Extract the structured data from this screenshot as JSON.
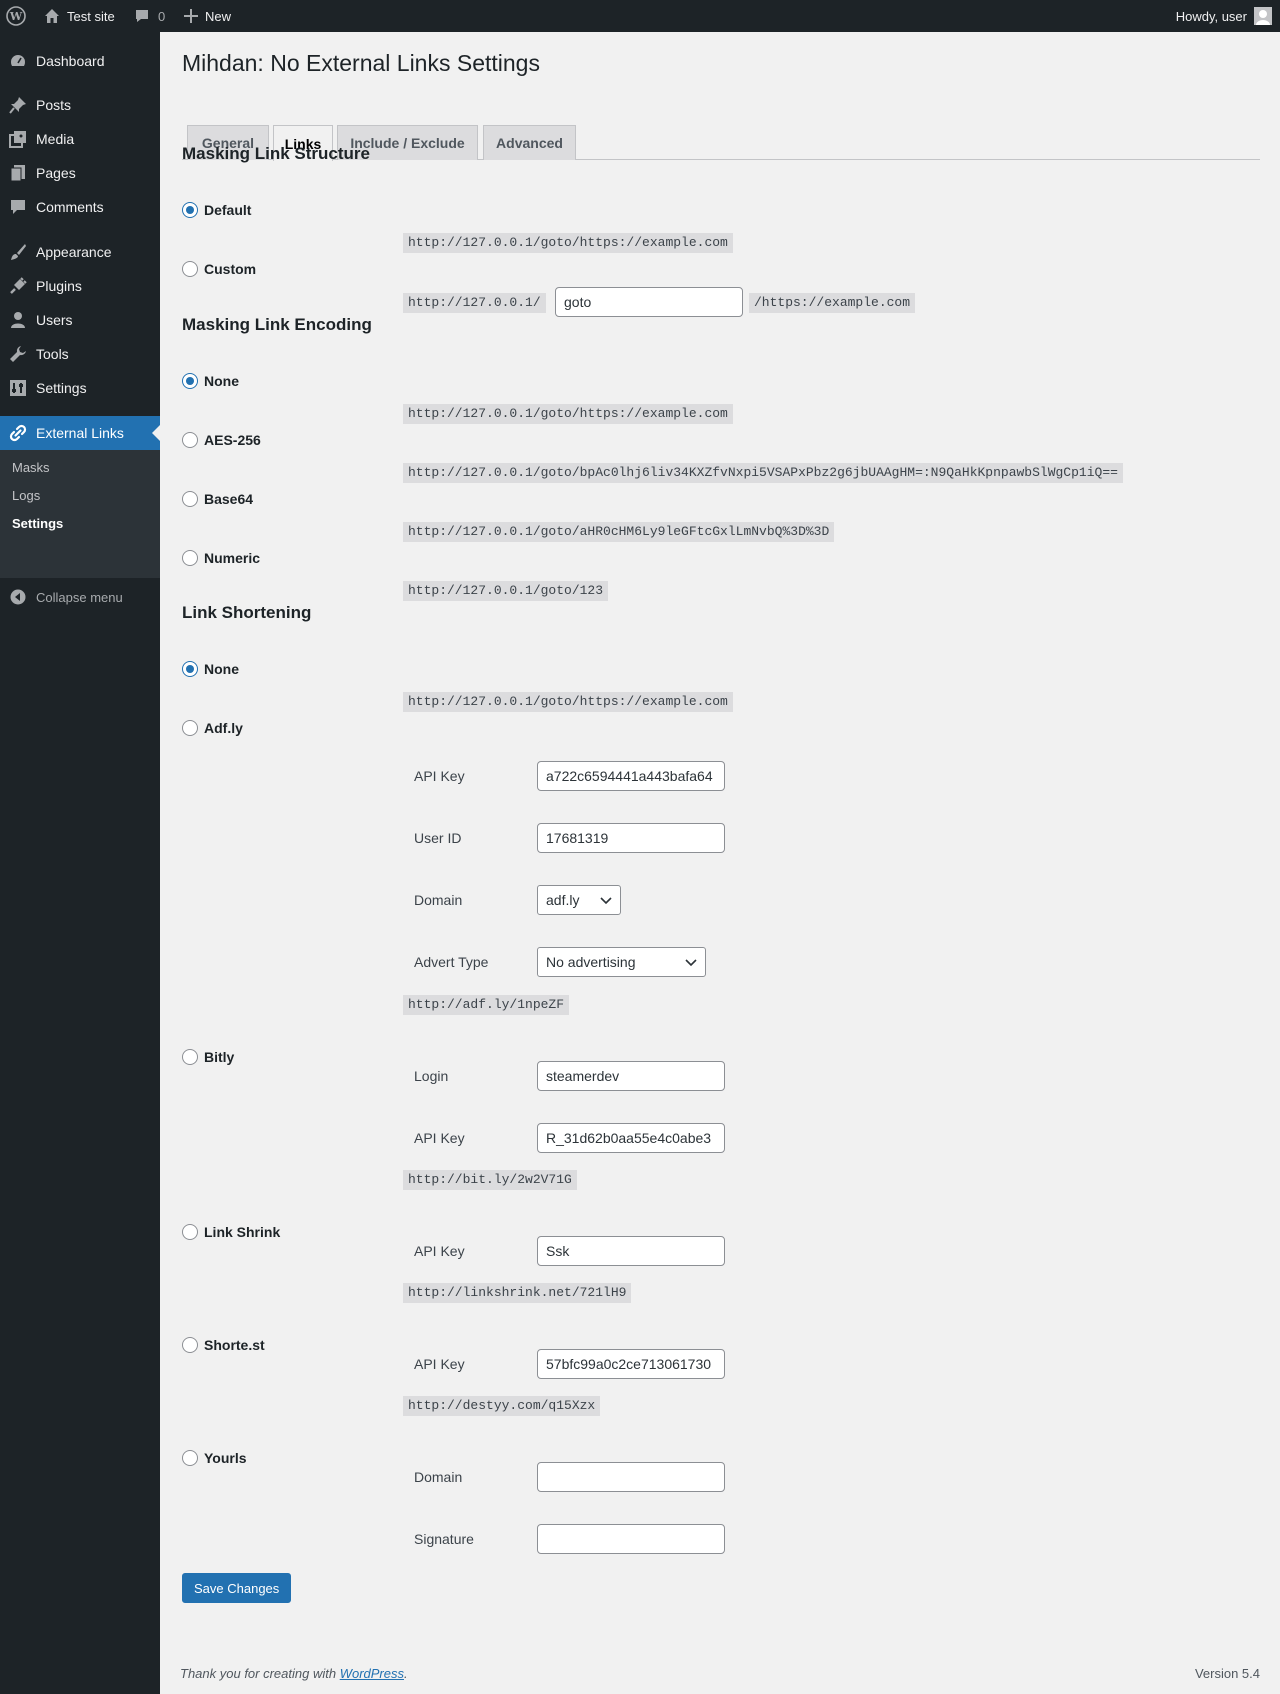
{
  "adminbar": {
    "site_name": "Test site",
    "comments_count": "0",
    "new_label": "New",
    "howdy": "Howdy, user"
  },
  "sidebar": {
    "items": [
      {
        "label": "Dashboard",
        "icon": "dashboard-icon"
      },
      {
        "label": "Posts",
        "icon": "pin-icon"
      },
      {
        "label": "Media",
        "icon": "media-icon"
      },
      {
        "label": "Pages",
        "icon": "pages-icon"
      },
      {
        "label": "Comments",
        "icon": "comment-icon"
      },
      {
        "label": "Appearance",
        "icon": "brush-icon"
      },
      {
        "label": "Plugins",
        "icon": "plug-icon"
      },
      {
        "label": "Users",
        "icon": "user-icon"
      },
      {
        "label": "Tools",
        "icon": "wrench-icon"
      },
      {
        "label": "Settings",
        "icon": "settings-icon"
      },
      {
        "label": "External Links",
        "icon": "link-icon"
      }
    ],
    "submenu": [
      "Masks",
      "Logs",
      "Settings"
    ],
    "collapse": "Collapse menu"
  },
  "page": {
    "title": "Mihdan: No External Links Settings",
    "tabs": [
      "General",
      "Links",
      "Include / Exclude",
      "Advanced"
    ],
    "active_tab": "Links"
  },
  "structure": {
    "heading": "Masking Link Structure",
    "default_label": "Default",
    "default_example": "http://127.0.0.1/goto/https://example.com",
    "custom_label": "Custom",
    "custom_prefix": "http://127.0.0.1/",
    "custom_value": "goto",
    "custom_suffix": "/https://example.com"
  },
  "encoding": {
    "heading": "Masking Link Encoding",
    "options": [
      {
        "label": "None",
        "example": "http://127.0.0.1/goto/https://example.com",
        "checked": true
      },
      {
        "label": "AES-256",
        "example": "http://127.0.0.1/goto/bpAc0lhj6liv34KXZfvNxpi5VSAPxPbz2g6jbUAAgHM=:N9QaHkKpnpawbSlWgCp1iQ==",
        "checked": false
      },
      {
        "label": "Base64",
        "example": "http://127.0.0.1/goto/aHR0cHM6Ly9leGFtcGxlLmNvbQ%3D%3D",
        "checked": false
      },
      {
        "label": "Numeric",
        "example": "http://127.0.0.1/goto/123",
        "checked": false
      }
    ]
  },
  "shortening": {
    "heading": "Link Shortening",
    "none": {
      "label": "None",
      "example": "http://127.0.0.1/goto/https://example.com"
    },
    "adfly": {
      "label": "Adf.ly",
      "api_key_label": "API Key",
      "api_key": "a722c6594441a443bafa64",
      "user_id_label": "User ID",
      "user_id": "17681319",
      "domain_label": "Domain",
      "domain": "adf.ly",
      "advert_label": "Advert Type",
      "advert": "No advertising",
      "example": "http://adf.ly/1npeZF"
    },
    "bitly": {
      "label": "Bitly",
      "login_label": "Login",
      "login": "steamerdev",
      "api_key_label": "API Key",
      "api_key": "R_31d62b0aa55e4c0abe3",
      "example": "http://bit.ly/2w2V71G"
    },
    "linkshrink": {
      "label": "Link Shrink",
      "api_key_label": "API Key",
      "api_key": "Ssk",
      "example": "http://linkshrink.net/721lH9"
    },
    "shortest": {
      "label": "Shorte.st",
      "api_key_label": "API Key",
      "api_key": "57bfc99a0c2ce713061730",
      "example": "http://destyy.com/q15Xzx"
    },
    "yourls": {
      "label": "Yourls",
      "domain_label": "Domain",
      "domain": "",
      "signature_label": "Signature",
      "signature": ""
    }
  },
  "save_label": "Save Changes",
  "footer": {
    "thanks_prefix": "Thank you for creating with ",
    "wordpress_link": "WordPress",
    "thanks_suffix": ".",
    "version": "Version 5.4"
  },
  "colors": {
    "accent": "#2271b1",
    "adminbar": "#1d2327",
    "background": "#f1f1f1"
  }
}
